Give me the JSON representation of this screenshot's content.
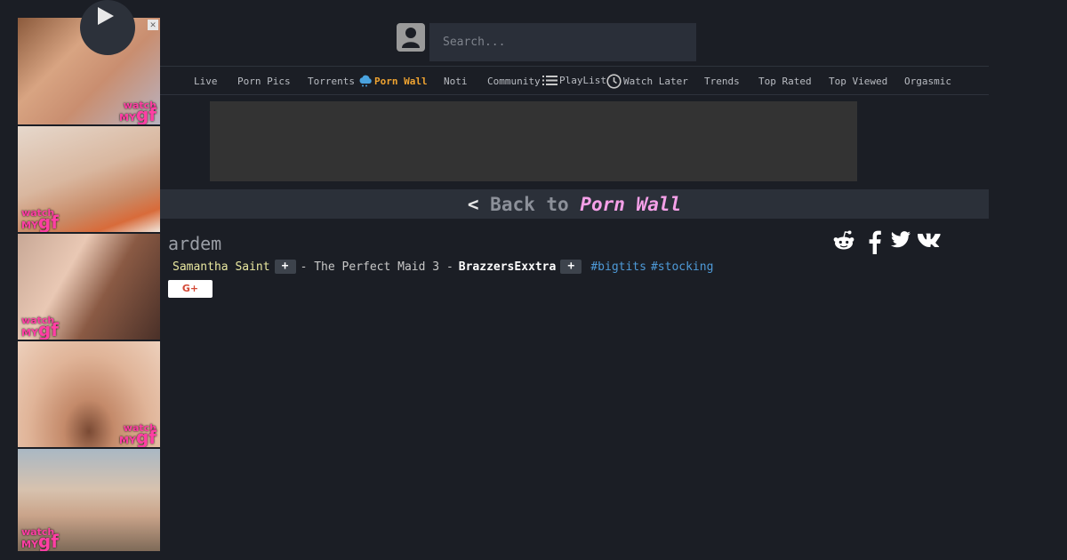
{
  "search": {
    "placeholder": "Search..."
  },
  "nav": [
    {
      "label": "Live"
    },
    {
      "label": "Porn Pics"
    },
    {
      "label": "Torrents"
    },
    {
      "label": "Porn Wall",
      "active": true,
      "icon": "cloud-icon"
    },
    {
      "label": "Noti"
    },
    {
      "label": "Community"
    },
    {
      "label": "PlayList",
      "icon": "list-icon"
    },
    {
      "label": "Watch Later",
      "icon": "clock-icon"
    },
    {
      "label": "Trends"
    },
    {
      "label": "Top Rated"
    },
    {
      "label": "Top Viewed"
    },
    {
      "label": "Orgasmic"
    }
  ],
  "back": {
    "arrow": "<",
    "prefix": "Back to",
    "target": "Porn Wall"
  },
  "post": {
    "title": "ardem",
    "model": "Samantha Saint",
    "plus": "+",
    "description": "- The Perfect Maid 3 -",
    "studio": "BrazzersExxtra",
    "hashtags": [
      "#bigtits",
      "#stocking"
    ],
    "gplus_label": "G+"
  },
  "ads": {
    "close_label": "✕",
    "badge_top": "watch",
    "badge_mid": "MY",
    "badge_big": "gf"
  },
  "colors": {
    "background": "#1b1e25",
    "accent": "#f0a431",
    "link": "#4e9ad8",
    "model": "#e9e8a0",
    "wall": "#f5a0e8"
  }
}
